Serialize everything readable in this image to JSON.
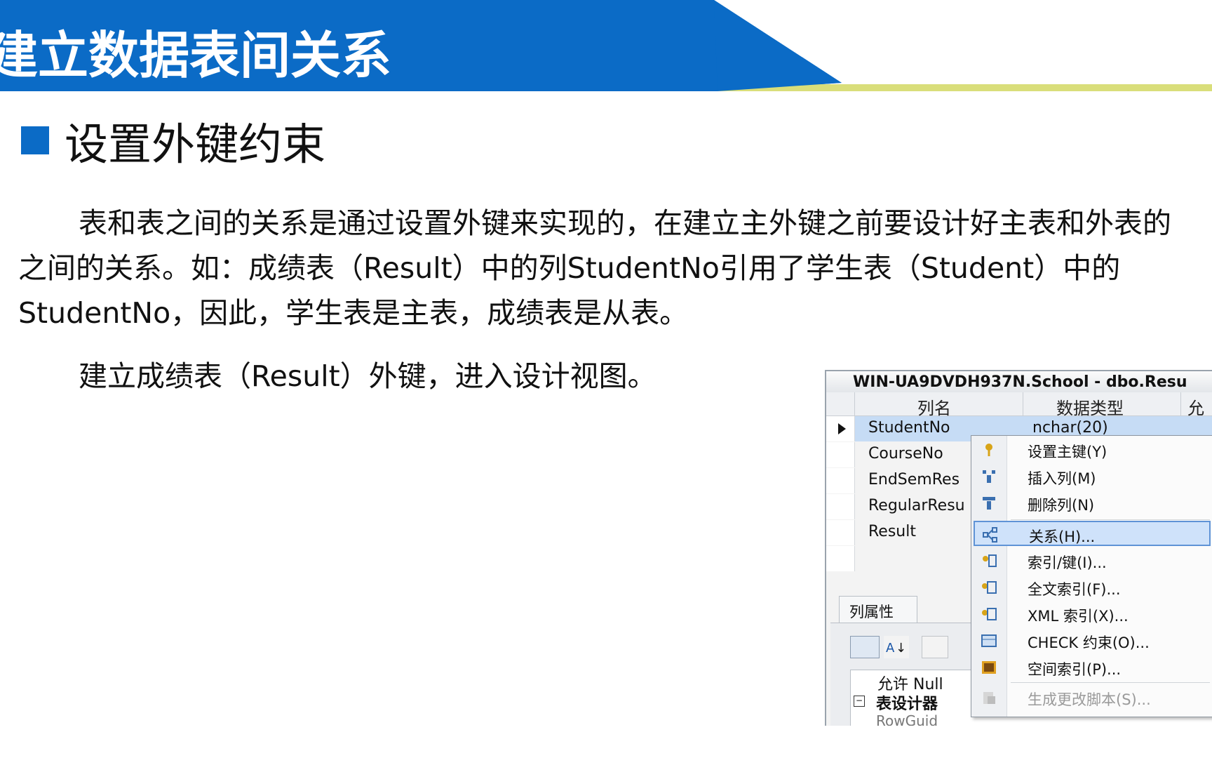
{
  "banner": {
    "title": "建立数据表间关系"
  },
  "section": {
    "heading": "设置外键约束"
  },
  "body": {
    "para1": "表和表之间的关系是通过设置外键来实现的，在建立主外键之前要设计好主表和外表的之间的关系。如：成绩表（Result）中的列StudentNo引用了学生表（Student）中的StudentNo，因此，学生表是主表，成绩表是从表。",
    "para2": "建立成绩表（Result）外键，进入设计视图。"
  },
  "designer": {
    "tab_title": "WIN-UA9DVDH937N.School - dbo.Resu",
    "columns": {
      "name": "列名",
      "type": "数据类型",
      "allow": "允"
    },
    "rows": [
      {
        "name": "StudentNo",
        "type": "nchar(20)"
      },
      {
        "name": "CourseNo",
        "type": ""
      },
      {
        "name": "EndSemRes",
        "type": ""
      },
      {
        "name": "RegularResu",
        "type": ""
      },
      {
        "name": "Result",
        "type": ""
      }
    ],
    "props_tab": "列属性",
    "props": {
      "allow_null": "允许 Null",
      "group": "表设计器",
      "row": "RowGuid"
    }
  },
  "context_menu": {
    "items": [
      {
        "label": "设置主键(Y)",
        "icon": "primary-key-icon"
      },
      {
        "label": "插入列(M)",
        "icon": "insert-column-icon"
      },
      {
        "label": "删除列(N)",
        "icon": "delete-column-icon"
      },
      {
        "label": "关系(H)...",
        "icon": "relationship-icon"
      },
      {
        "label": "索引/键(I)...",
        "icon": "index-key-icon"
      },
      {
        "label": "全文索引(F)...",
        "icon": "fulltext-index-icon"
      },
      {
        "label": "XML 索引(X)...",
        "icon": "xml-index-icon"
      },
      {
        "label": "CHECK 约束(O)...",
        "icon": "check-constraint-icon"
      },
      {
        "label": "空间索引(P)...",
        "icon": "spatial-index-icon"
      },
      {
        "label": "生成更改脚本(S)...",
        "icon": "generate-script-icon"
      }
    ]
  },
  "colors": {
    "brand_blue": "#0b6bc6",
    "accent_yellow": "#d9de7a",
    "menu_highlight": "#cfe2fa"
  }
}
